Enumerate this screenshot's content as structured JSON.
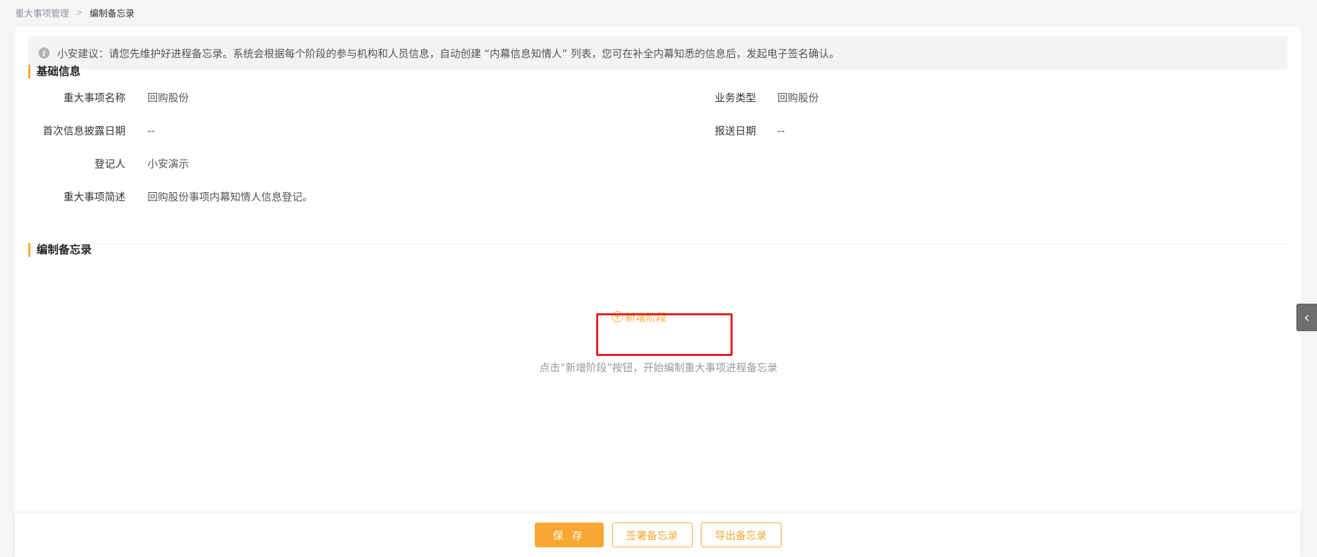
{
  "breadcrumb": {
    "parent": "重大事项管理",
    "separator": ">",
    "current": "编制备忘录"
  },
  "tip": {
    "icon": "info-icon",
    "text": "小安建议：请您先维护好进程备忘录。系统会根据每个阶段的参与机构和人员信息，自动创建 “内幕信息知情人” 列表，您可在补全内幕知悉的信息后，发起电子签名确认。"
  },
  "basic_info": {
    "title": "基础信息",
    "fields": [
      {
        "label": "重大事项名称",
        "value": "回购股份"
      },
      {
        "label": "业务类型",
        "value": "回购股份"
      },
      {
        "label": "首次信息披露日期",
        "value": "--"
      },
      {
        "label": "报送日期",
        "value": "--"
      },
      {
        "label": "登记人",
        "value": "小安演示"
      },
      {
        "label": "重大事项简述",
        "value": "回购股份事项内幕知情人信息登记。"
      }
    ]
  },
  "memo": {
    "title": "编制备忘录",
    "add_stage_label": "新增阶段",
    "hint": "点击“新增阶段”按钮，开始编制重大事项进程备忘录"
  },
  "footer": {
    "save_label": "保 存",
    "sign_label": "签署备忘录",
    "export_label": "导出备忘录"
  },
  "colors": {
    "accent": "#f7a833",
    "highlight": "#e31f1f"
  }
}
